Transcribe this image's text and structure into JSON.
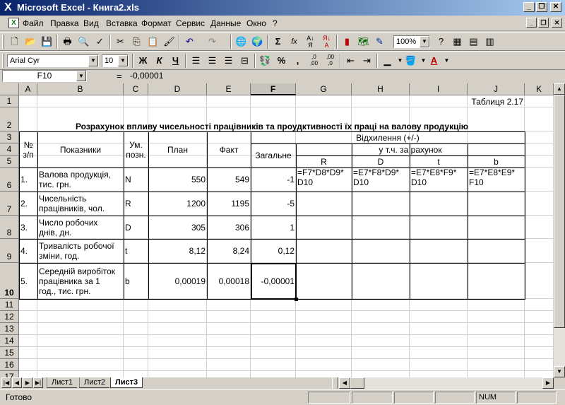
{
  "window": {
    "title": "Microsoft Excel - Книга2.xls",
    "app_icon": "excel-icon"
  },
  "menu": [
    "Файл",
    "Правка",
    "Вид",
    "Вставка",
    "Формат",
    "Сервис",
    "Данные",
    "Окно",
    "?"
  ],
  "toolbar": {
    "zoom": "100%",
    "font_name": "Arial Cyr",
    "font_size": "10",
    "bold": "Ж",
    "italic": "К",
    "underline": "Ч",
    "percent": "%",
    "thousands": ",",
    "inc_decimal": ",0\n,00",
    "dec_decimal": ",00\n,0",
    "sum": "Σ",
    "fx": "fx"
  },
  "formula_bar": {
    "name_box": "F10",
    "eq": "=",
    "value": "-0,00001"
  },
  "columns": [
    "A",
    "B",
    "C",
    "D",
    "E",
    "F",
    "G",
    "H",
    "I",
    "J",
    "K"
  ],
  "rows": [
    "1",
    "2",
    "3",
    "4",
    "5",
    "6",
    "7",
    "8",
    "9",
    "10",
    "11",
    "12",
    "13",
    "14",
    "15",
    "16",
    "17"
  ],
  "cells": {
    "J1": "Таблиця 2.17",
    "title": "Розрахунок впливу чисельності працівників та проудктивності їх праці на валову продукцію",
    "hdr_num": "№\nз/п",
    "hdr_ind": "Показники",
    "hdr_unit": "Ум.\nпозн.",
    "hdr_plan": "План",
    "hdr_fact": "Факт",
    "hdr_dev": "Відхилення (+/-)",
    "hdr_total": "Загальне",
    "hdr_incl": "у т.ч. за рахунок",
    "hdr_R": "R",
    "hdr_D": "D",
    "hdr_t": "t",
    "hdr_b": "b",
    "r6": {
      "num": "1.",
      "name": "Валова продукція,\nтис. грн.",
      "unit": "N",
      "plan": "550",
      "fact": "549",
      "total": "-1",
      "G": "=F7*D8*D9*\nD10",
      "H": "=E7*F8*D9*\nD10",
      "I": "=E7*E8*F9*\nD10",
      "J": "=E7*E8*E9*\nF10"
    },
    "r7": {
      "num": "2.",
      "name": "Чисельність\nпрацівників, чол.",
      "unit": "R",
      "plan": "1200",
      "fact": "1195",
      "total": "-5"
    },
    "r8": {
      "num": "3.",
      "name": "Число робочих\nднів, дн.",
      "unit": "D",
      "plan": "305",
      "fact": "306",
      "total": "1"
    },
    "r9": {
      "num": "4.",
      "name": "Тривалість робочої\nзміни, год.",
      "unit": "t",
      "plan": "8,12",
      "fact": "8,24",
      "total": "0,12"
    },
    "r10": {
      "num": "5.",
      "name": "Середній виробіток\nпрацівника за 1\nгод., тис. грн.",
      "unit": "b",
      "plan": "0,00019",
      "fact": "0,00018",
      "total": "-0,00001"
    }
  },
  "sheet_tabs": [
    "Лист1",
    "Лист2",
    "Лист3"
  ],
  "active_tab": "Лист3",
  "status": {
    "text": "Готово",
    "num": "NUM"
  },
  "colors": {
    "title_start": "#0a246a",
    "title_end": "#a6caf0",
    "chrome": "#d4d0c8"
  }
}
